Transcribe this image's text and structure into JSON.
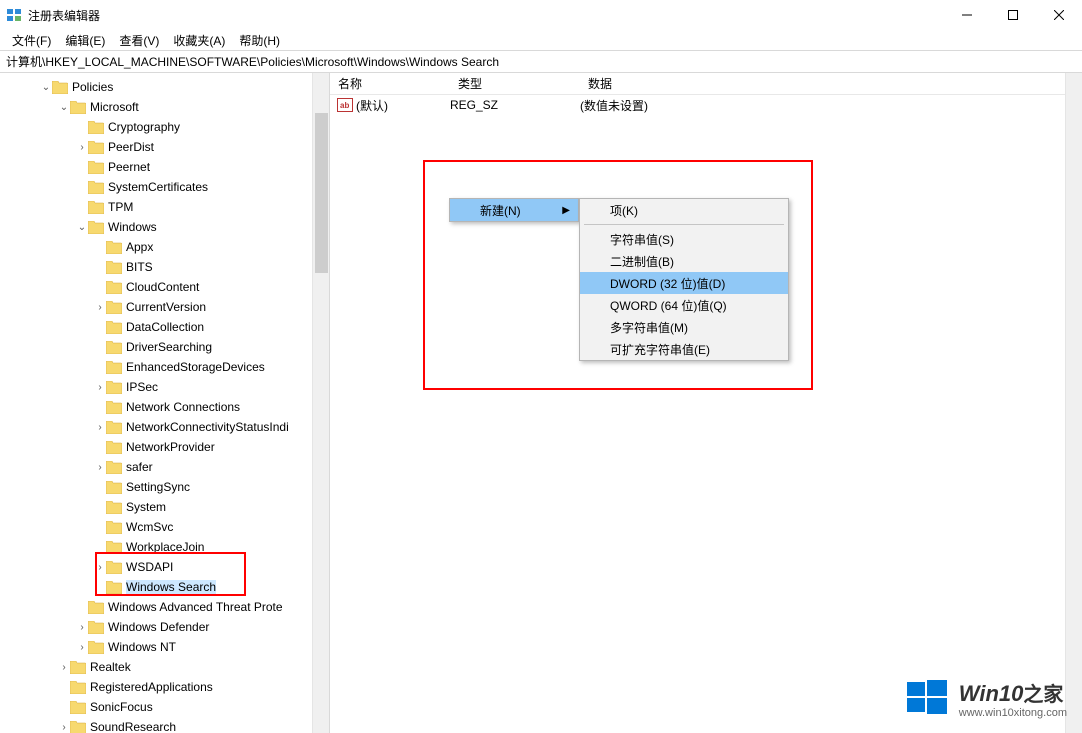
{
  "window": {
    "title": "注册表编辑器"
  },
  "menubar": {
    "file": "文件(F)",
    "edit": "编辑(E)",
    "view": "查看(V)",
    "favorites": "收藏夹(A)",
    "help": "帮助(H)"
  },
  "addressbar": {
    "path": "计算机\\HKEY_LOCAL_MACHINE\\SOFTWARE\\Policies\\Microsoft\\Windows\\Windows Search"
  },
  "columns": {
    "name": "名称",
    "type": "类型",
    "data": "数据"
  },
  "values_row": {
    "name": "(默认)",
    "type": "REG_SZ",
    "data": "(数值未设置)"
  },
  "tree": [
    {
      "indent": 2,
      "exp": "open",
      "label": "Policies"
    },
    {
      "indent": 3,
      "exp": "open",
      "label": "Microsoft"
    },
    {
      "indent": 4,
      "exp": "none",
      "label": "Cryptography"
    },
    {
      "indent": 4,
      "exp": "closed",
      "label": "PeerDist"
    },
    {
      "indent": 4,
      "exp": "none",
      "label": "Peernet"
    },
    {
      "indent": 4,
      "exp": "none",
      "label": "SystemCertificates"
    },
    {
      "indent": 4,
      "exp": "none",
      "label": "TPM"
    },
    {
      "indent": 4,
      "exp": "open",
      "label": "Windows"
    },
    {
      "indent": 5,
      "exp": "none",
      "label": "Appx"
    },
    {
      "indent": 5,
      "exp": "none",
      "label": "BITS"
    },
    {
      "indent": 5,
      "exp": "none",
      "label": "CloudContent"
    },
    {
      "indent": 5,
      "exp": "closed",
      "label": "CurrentVersion"
    },
    {
      "indent": 5,
      "exp": "none",
      "label": "DataCollection"
    },
    {
      "indent": 5,
      "exp": "none",
      "label": "DriverSearching"
    },
    {
      "indent": 5,
      "exp": "none",
      "label": "EnhancedStorageDevices"
    },
    {
      "indent": 5,
      "exp": "closed",
      "label": "IPSec"
    },
    {
      "indent": 5,
      "exp": "none",
      "label": "Network Connections"
    },
    {
      "indent": 5,
      "exp": "closed",
      "label": "NetworkConnectivityStatusIndi"
    },
    {
      "indent": 5,
      "exp": "none",
      "label": "NetworkProvider"
    },
    {
      "indent": 5,
      "exp": "closed",
      "label": "safer"
    },
    {
      "indent": 5,
      "exp": "none",
      "label": "SettingSync"
    },
    {
      "indent": 5,
      "exp": "none",
      "label": "System"
    },
    {
      "indent": 5,
      "exp": "none",
      "label": "WcmSvc"
    },
    {
      "indent": 5,
      "exp": "none",
      "label": "WorkplaceJoin"
    },
    {
      "indent": 5,
      "exp": "closed",
      "label": "WSDAPI"
    },
    {
      "indent": 5,
      "exp": "none",
      "label": "Windows Search",
      "selected": true
    },
    {
      "indent": 4,
      "exp": "none",
      "label": "Windows Advanced Threat Prote"
    },
    {
      "indent": 4,
      "exp": "closed",
      "label": "Windows Defender"
    },
    {
      "indent": 4,
      "exp": "closed",
      "label": "Windows NT"
    },
    {
      "indent": 3,
      "exp": "closed",
      "label": "Realtek"
    },
    {
      "indent": 3,
      "exp": "none",
      "label": "RegisteredApplications"
    },
    {
      "indent": 3,
      "exp": "none",
      "label": "SonicFocus"
    },
    {
      "indent": 3,
      "exp": "closed",
      "label": "SoundResearch"
    }
  ],
  "context_menu_1": {
    "new": "新建(N)"
  },
  "context_menu_2": {
    "key": "项(K)",
    "string": "字符串值(S)",
    "binary": "二进制值(B)",
    "dword": "DWORD (32 位)值(D)",
    "qword": "QWORD (64 位)值(Q)",
    "multi": "多字符串值(M)",
    "expand": "可扩充字符串值(E)"
  },
  "watermark": {
    "title_en": "Win10",
    "title_zh": "之家",
    "url": "www.win10xitong.com"
  }
}
